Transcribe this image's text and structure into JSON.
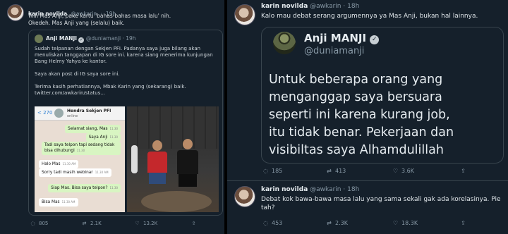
{
  "left": {
    "tweet": {
      "name": "karin novilda",
      "handle": "@awkarin",
      "time": "19h",
      "lines": [
        "Wih Mas Anji, pake kartu 'bahas-bahas masa lalu' nih.",
        "Okedeh. Mas Anji yang (selalu) baik."
      ]
    },
    "quote": {
      "name": "Anji MANJI",
      "handle": "@duniamanji",
      "time": "19h",
      "lines": [
        "Sudah telpanan dengan Sekjen PFI. Padanya saya juga bilang akan",
        "menuliskan tanggapan di IG sore ini. karena siang menerima kunjungan",
        "Bang Helmy Yahya ke kantor.",
        "",
        "Saya akan post di IG saya sore ini.",
        "",
        "Terima kasih perhatiannya, Mbak Karin yang (sekarang) baik.",
        "twitter.com/awkarin/status..."
      ]
    },
    "chat": {
      "back": "< 270",
      "contact": "Hendra Sekjen PFI",
      "status": "online",
      "messages": [
        {
          "dir": "out",
          "text": "Selamat siang, Mas",
          "time": "11.30"
        },
        {
          "dir": "out",
          "text": "Saya Anji",
          "time": "11.30"
        },
        {
          "dir": "out",
          "text": "Tadi saya telpon tapi sedang tidak bisa",
          "time": ""
        },
        {
          "dir": "out",
          "text": "dihubungi",
          "time": "11.30"
        },
        {
          "dir": "in",
          "text": "Halo Mas",
          "time": "11.30 AM"
        },
        {
          "dir": "in",
          "text": "Sorry tadi masih webinar",
          "time": "11.30 AM"
        },
        {
          "dir": "out",
          "text": "Siap Mas. Bisa saya telpon?",
          "time": "11.30"
        },
        {
          "dir": "in",
          "text": "Bisa Mas",
          "time": "11.30 AM"
        }
      ]
    },
    "actions": {
      "reply": "805",
      "retweet": "2.1K",
      "like": "13.2K"
    }
  },
  "right": {
    "tweet1": {
      "name": "karin novilda",
      "handle": "@awkarin",
      "time": "18h",
      "text": "Kalo mau debat serang argumennya ya Mas Anji, bukan hal lainnya."
    },
    "quote": {
      "name": "Anji MANJI",
      "handle": "@duniamanji",
      "lines": [
        "Untuk beberapa orang yang",
        "menganggap saya bersuara",
        "seperti ini karena kurang job,",
        "itu tidak benar. Pekerjaan dan",
        "visibiltas saya Alhamdulillah"
      ]
    },
    "actions1": {
      "reply": "185",
      "retweet": "413",
      "like": "3.6K"
    },
    "tweet2": {
      "name": "karin novilda",
      "handle": "@awkarin",
      "time": "18h",
      "lines": [
        "Debat kok bawa-bawa masa lalu yang sama sekali gak ada korelasinya. Pie",
        "tah?"
      ]
    },
    "actions2": {
      "reply": "453",
      "retweet": "2.3K",
      "like": "18.3K"
    }
  },
  "icons": {
    "reply": "reply-icon",
    "retweet": "retweet-icon",
    "like": "heart-icon",
    "share": "share-icon",
    "verified": "verified-badge-icon"
  }
}
